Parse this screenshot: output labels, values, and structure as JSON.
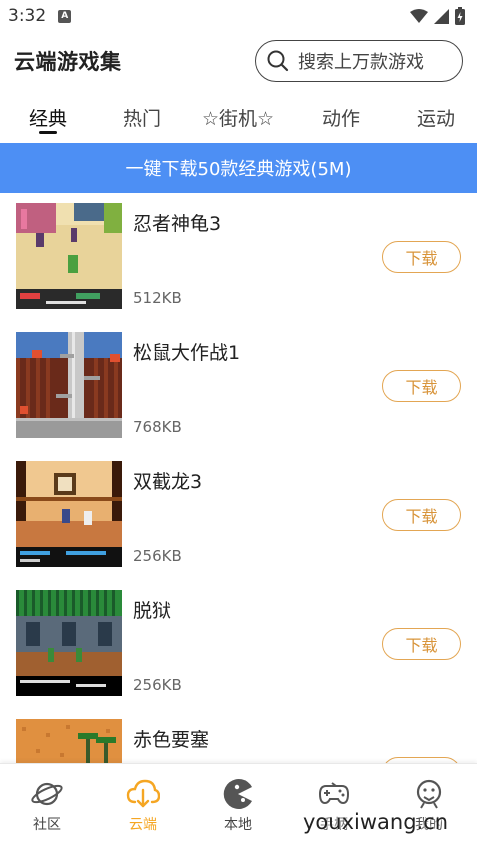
{
  "status_bar": {
    "time": "3:32",
    "notification_badge": "A"
  },
  "header": {
    "title": "云端游戏集",
    "search_placeholder": "搜索上万款游戏"
  },
  "tabs": [
    "经典",
    "热门",
    "☆街机☆",
    "动作",
    "运动"
  ],
  "active_tab": "经典",
  "banner": "一键下载50款经典游戏(5M)",
  "download_label": "下载",
  "games": [
    {
      "name": "忍者神龟3",
      "size": "512KB"
    },
    {
      "name": "松鼠大作战1",
      "size": "768KB"
    },
    {
      "name": "双截龙3",
      "size": "256KB"
    },
    {
      "name": "脱狱",
      "size": "256KB"
    },
    {
      "name": "赤色要塞",
      "size": ""
    }
  ],
  "bottom_nav": [
    {
      "label": "社区",
      "icon": "planet-icon"
    },
    {
      "label": "云端",
      "icon": "cloud-download-icon"
    },
    {
      "label": "本地",
      "icon": "pacman-icon"
    },
    {
      "label": "手柄",
      "icon": "gamepad-icon"
    },
    {
      "label": "我的",
      "icon": "profile-icon"
    }
  ],
  "active_nav": "云端",
  "watermark": "youxiwang.cn",
  "colors": {
    "accent_blue": "#4d8ff4",
    "download_orange": "#d8943a",
    "nav_active": "#f5a623"
  }
}
